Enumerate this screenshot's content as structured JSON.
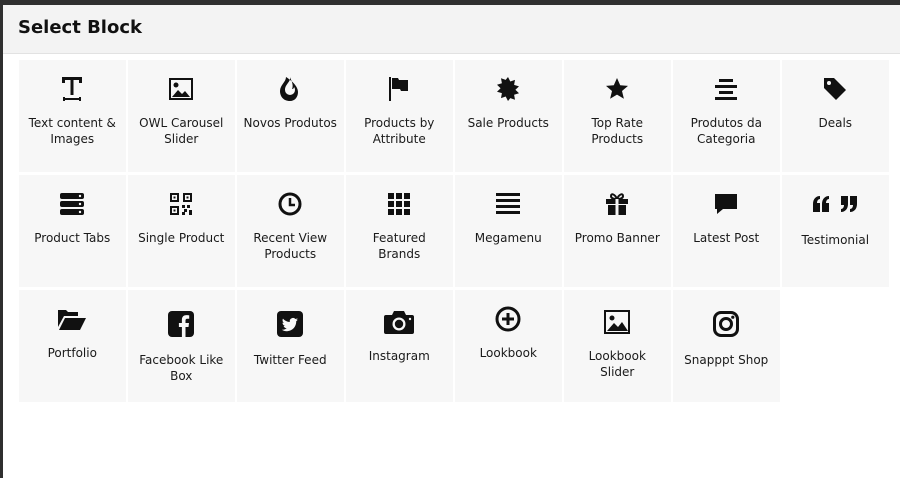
{
  "modal": {
    "title": "Select Block"
  },
  "blocks": [
    {
      "label": "Text content & Images",
      "icon": "text-icon"
    },
    {
      "label": "OWL Carousel Slider",
      "icon": "image-icon"
    },
    {
      "label": "Novos Produtos",
      "icon": "fire-icon"
    },
    {
      "label": "Products by Attribute",
      "icon": "flag-icon"
    },
    {
      "label": "Sale Products",
      "icon": "starburst-icon"
    },
    {
      "label": "Top Rate Products",
      "icon": "star-icon"
    },
    {
      "label": "Produtos da Categoria",
      "icon": "align-center-icon"
    },
    {
      "label": "Deals",
      "icon": "tag-icon"
    },
    {
      "label": "Product Tabs",
      "icon": "server-icon"
    },
    {
      "label": "Single Product",
      "icon": "qrcode-icon"
    },
    {
      "label": "Recent View Products",
      "icon": "clock-icon"
    },
    {
      "label": "Featured Brands",
      "icon": "grid-icon"
    },
    {
      "label": "Megamenu",
      "icon": "menu-lines-icon"
    },
    {
      "label": "Promo Banner",
      "icon": "gift-icon"
    },
    {
      "label": "Latest Post",
      "icon": "comment-icon"
    },
    {
      "label": "Testimonial",
      "icon": "quote-icon"
    },
    {
      "label": "Portfolio",
      "icon": "folder-open-icon"
    },
    {
      "label": "Facebook Like Box",
      "icon": "facebook-icon"
    },
    {
      "label": "Twitter Feed",
      "icon": "twitter-icon"
    },
    {
      "label": "Instagram",
      "icon": "camera-icon"
    },
    {
      "label": "Lookbook",
      "icon": "plus-circle-icon"
    },
    {
      "label": "Lookbook Slider",
      "icon": "picture-icon"
    },
    {
      "label": "Snapppt Shop",
      "icon": "instagram-icon"
    }
  ]
}
